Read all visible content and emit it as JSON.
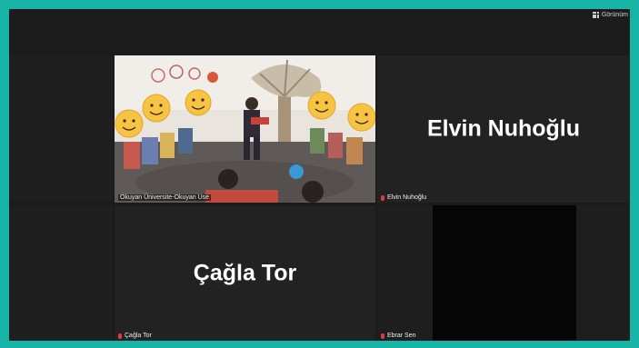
{
  "toolbar": {
    "view_label": "Görünüm"
  },
  "participants": {
    "featured": {
      "name": "Okuyan Üniversite-Okuyan Use"
    },
    "p1": {
      "display_name": "Elvin Nuhoğlu",
      "label": "Elvin Nuhoğlu"
    },
    "p2": {
      "display_name": "Çağla Tor",
      "label": "Çağla Tor"
    },
    "p3": {
      "label": "Ebrar Sen"
    }
  },
  "colors": {
    "frame": "#16b3a6",
    "active_speaker_border": "#c6e27a",
    "mic_muted": "#e0394a"
  }
}
